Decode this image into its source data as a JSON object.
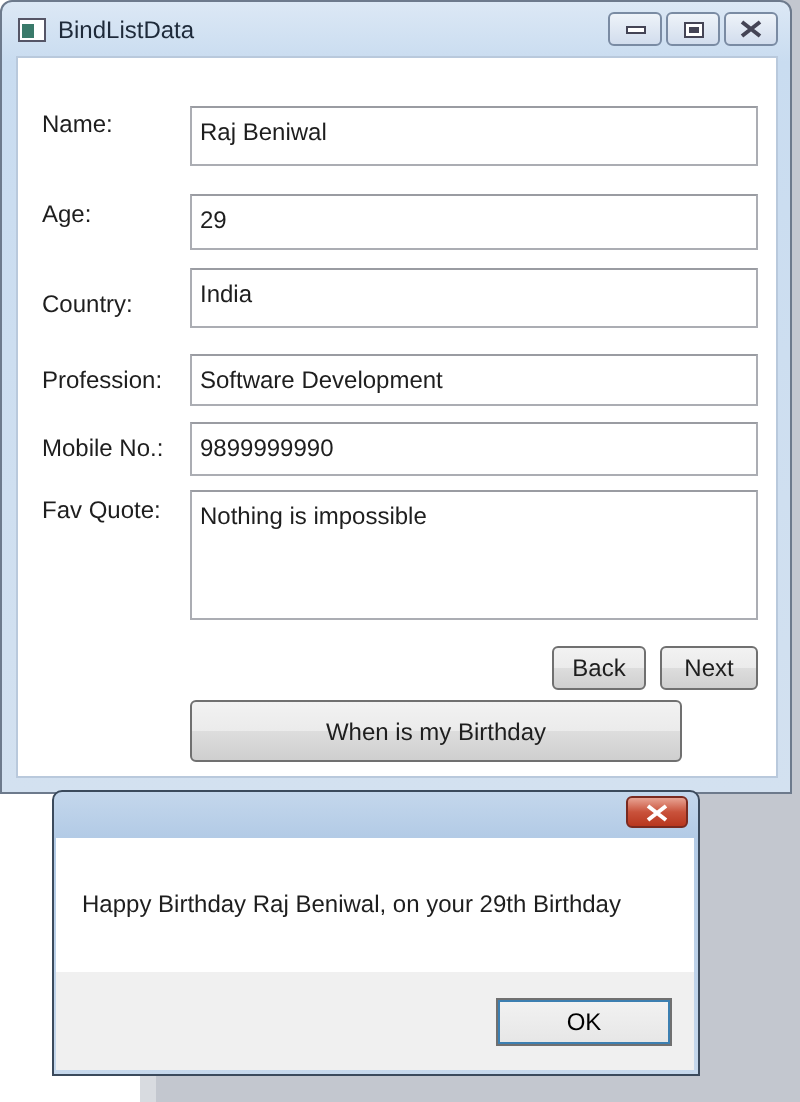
{
  "window": {
    "title": "BindListData"
  },
  "fields": [
    {
      "label": "Name:",
      "value": "Raj Beniwal",
      "kind": "single"
    },
    {
      "label": "Age:",
      "value": "29",
      "kind": "single"
    },
    {
      "label": "Country:",
      "value": "India",
      "kind": "single"
    },
    {
      "label": "Profession:",
      "value": "Software Development",
      "kind": "single"
    },
    {
      "label": "Mobile No.:",
      "value": "9899999990",
      "kind": "single"
    },
    {
      "label": "Fav Quote:",
      "value": "Nothing is impossible",
      "kind": "multi"
    }
  ],
  "nav_buttons": [
    "Back",
    "Next"
  ],
  "birthday_button": "When is my Birthday",
  "dialog": {
    "message": "Happy Birthday Raj Beniwal, on your 29th Birthday",
    "button": "OK"
  }
}
